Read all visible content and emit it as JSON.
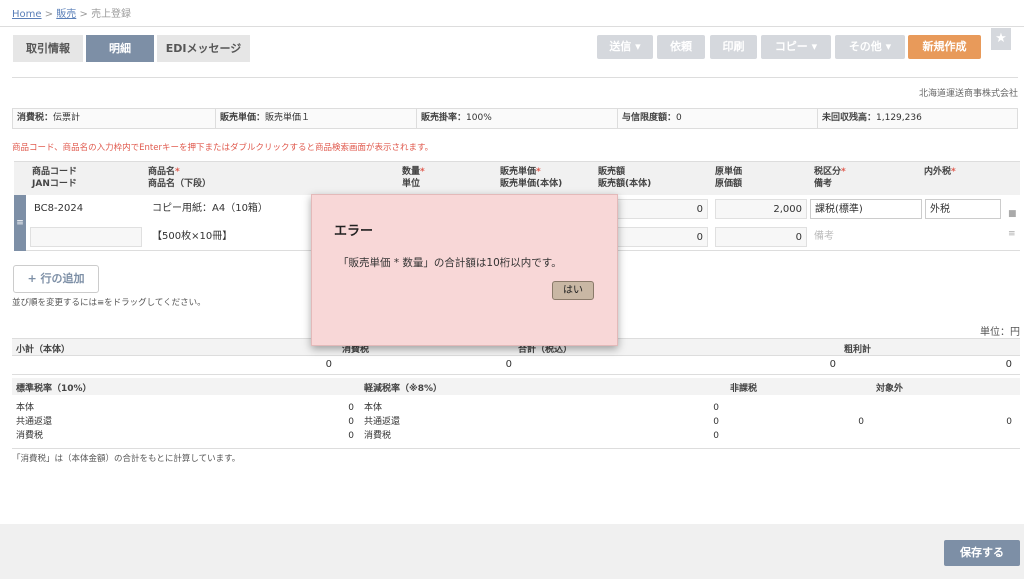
{
  "breadcrumb": {
    "home": "Home",
    "sales": "販売",
    "sep": ">",
    "current": "売上登録"
  },
  "tabs": [
    "取引情報",
    "明細",
    "EDIメッセージ"
  ],
  "toolbar": {
    "send": "送信 ▾",
    "request": "依頼",
    "print": "印刷",
    "copy": "コピー ▾",
    "other": "その他 ▾",
    "new": "新規作成",
    "star": "★"
  },
  "company": "北海道運送商事株式会社",
  "info": {
    "tax_label": "消費税：",
    "tax_value": "伝票計",
    "price_label": "販売単価：",
    "price_value": "販売単価１",
    "rate_label": "販売掛率：",
    "rate_value": "100%",
    "credit_label": "与信限度額：",
    "credit_value": "0",
    "uncollected_label": "未回収残高：",
    "uncollected_value": "1,129,236"
  },
  "warning": "商品コード、商品名の入力枠内でEnterキーを押下またはダブルクリックすると商品検索画面が表示されます。",
  "grid_headers": {
    "code": "商品コード",
    "jan": "JANコード",
    "name": "商品名",
    "name_sub": "商品名（下段）",
    "qty": "数量",
    "unit": "単位",
    "price": "販売単価",
    "price_sub": "販売単価(本体)",
    "amount": "販売額",
    "amount_sub": "販売額(本体)",
    "cost": "原単価",
    "cost_sub": "原価額",
    "taxcat": "税区分",
    "memo": "備考",
    "inctax": "内外税",
    "req": "*"
  },
  "row": {
    "code": "BC8-2024",
    "name": "コピー用紙：A4（10箱）",
    "name2": "【500枚×10冊】",
    "amount": "0",
    "amount2": "0",
    "cost": "2,000",
    "cost2": "0",
    "taxcat": "課税(標準)",
    "inctax": "外税",
    "memo_placeholder": "備考",
    "handle": "≡"
  },
  "add_row": "+ 行の追加",
  "sort_note": "並び順を変更するには≡をドラッグしてください。",
  "unit_label": "単位：円",
  "summary": {
    "subtotal": "小計（本体）",
    "tax": "消費税",
    "total": "合計（税込）",
    "gross": "粗利計",
    "v1": "0",
    "v2": "0",
    "v3": "0",
    "v4": "0"
  },
  "taxbreak": {
    "std": "標準税率（10%）",
    "reduced": "軽減税率（※8%）",
    "exempt": "非課税",
    "outside": "対象外",
    "body": "本体",
    "refund": "共通返還",
    "tax": "消費税",
    "sv1": "0",
    "sv2": "0",
    "sv3": "0",
    "rv1": "0",
    "rv2": "0",
    "rv3": "0",
    "ev": "0",
    "ov": "0"
  },
  "tax_note": "「消費税」は（本体金額）の合計をもとに計算しています。",
  "save": "保存する",
  "modal": {
    "title": "エラー",
    "message": "「販売単価 * 数量」の合計額は10桁以内です。",
    "ok": "はい"
  }
}
